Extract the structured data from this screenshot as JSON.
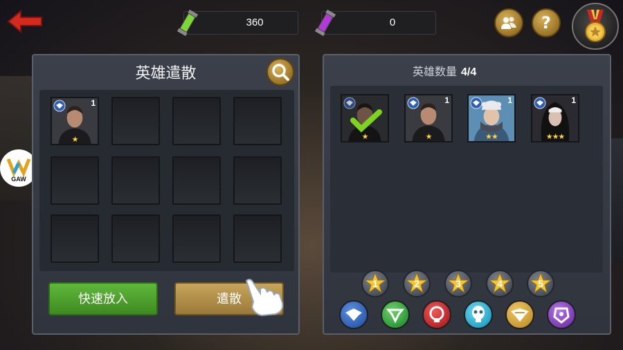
{
  "header": {
    "resource_green_value": "360",
    "resource_purple_value": "0",
    "help_label": "?"
  },
  "left_panel": {
    "title": "英雄遣散",
    "slots": [
      {
        "filled": true,
        "level": "1",
        "stars": "★"
      },
      {
        "filled": false
      },
      {
        "filled": false
      },
      {
        "filled": false
      },
      {
        "filled": false
      },
      {
        "filled": false
      },
      {
        "filled": false
      },
      {
        "filled": false
      },
      {
        "filled": false
      },
      {
        "filled": false
      },
      {
        "filled": false
      },
      {
        "filled": false
      }
    ],
    "quick_add_label": "快速放入",
    "dismiss_label": "遣散"
  },
  "right_panel": {
    "title": "英雄数量",
    "count": "4/4",
    "heroes": [
      {
        "level": "",
        "stars": "★",
        "selected": true
      },
      {
        "level": "1",
        "stars": "★",
        "selected": false
      },
      {
        "level": "1",
        "stars": "★★",
        "selected": false
      },
      {
        "level": "1",
        "stars": "★★★",
        "selected": false
      }
    ],
    "star_filters": [
      "1",
      "2",
      "3",
      "4",
      "5"
    ],
    "faction_filters": [
      {
        "icon": "eagle-blue-icon",
        "color": "#2f5fb0"
      },
      {
        "icon": "emblem-green-icon",
        "color": "#2f9a3a"
      },
      {
        "icon": "skull-red-icon",
        "color": "#b8262a"
      },
      {
        "icon": "skull-cyan-icon",
        "color": "#2aa6c8"
      },
      {
        "icon": "eagle-gold-icon",
        "color": "#c89a32"
      },
      {
        "icon": "emblem-purple-icon",
        "color": "#7a3bb0"
      }
    ]
  },
  "watermark": {
    "text": "GAW"
  },
  "colors": {
    "green_button": "#4ea22e",
    "gold_button": "#b8944b",
    "star": "#ffd23a"
  }
}
